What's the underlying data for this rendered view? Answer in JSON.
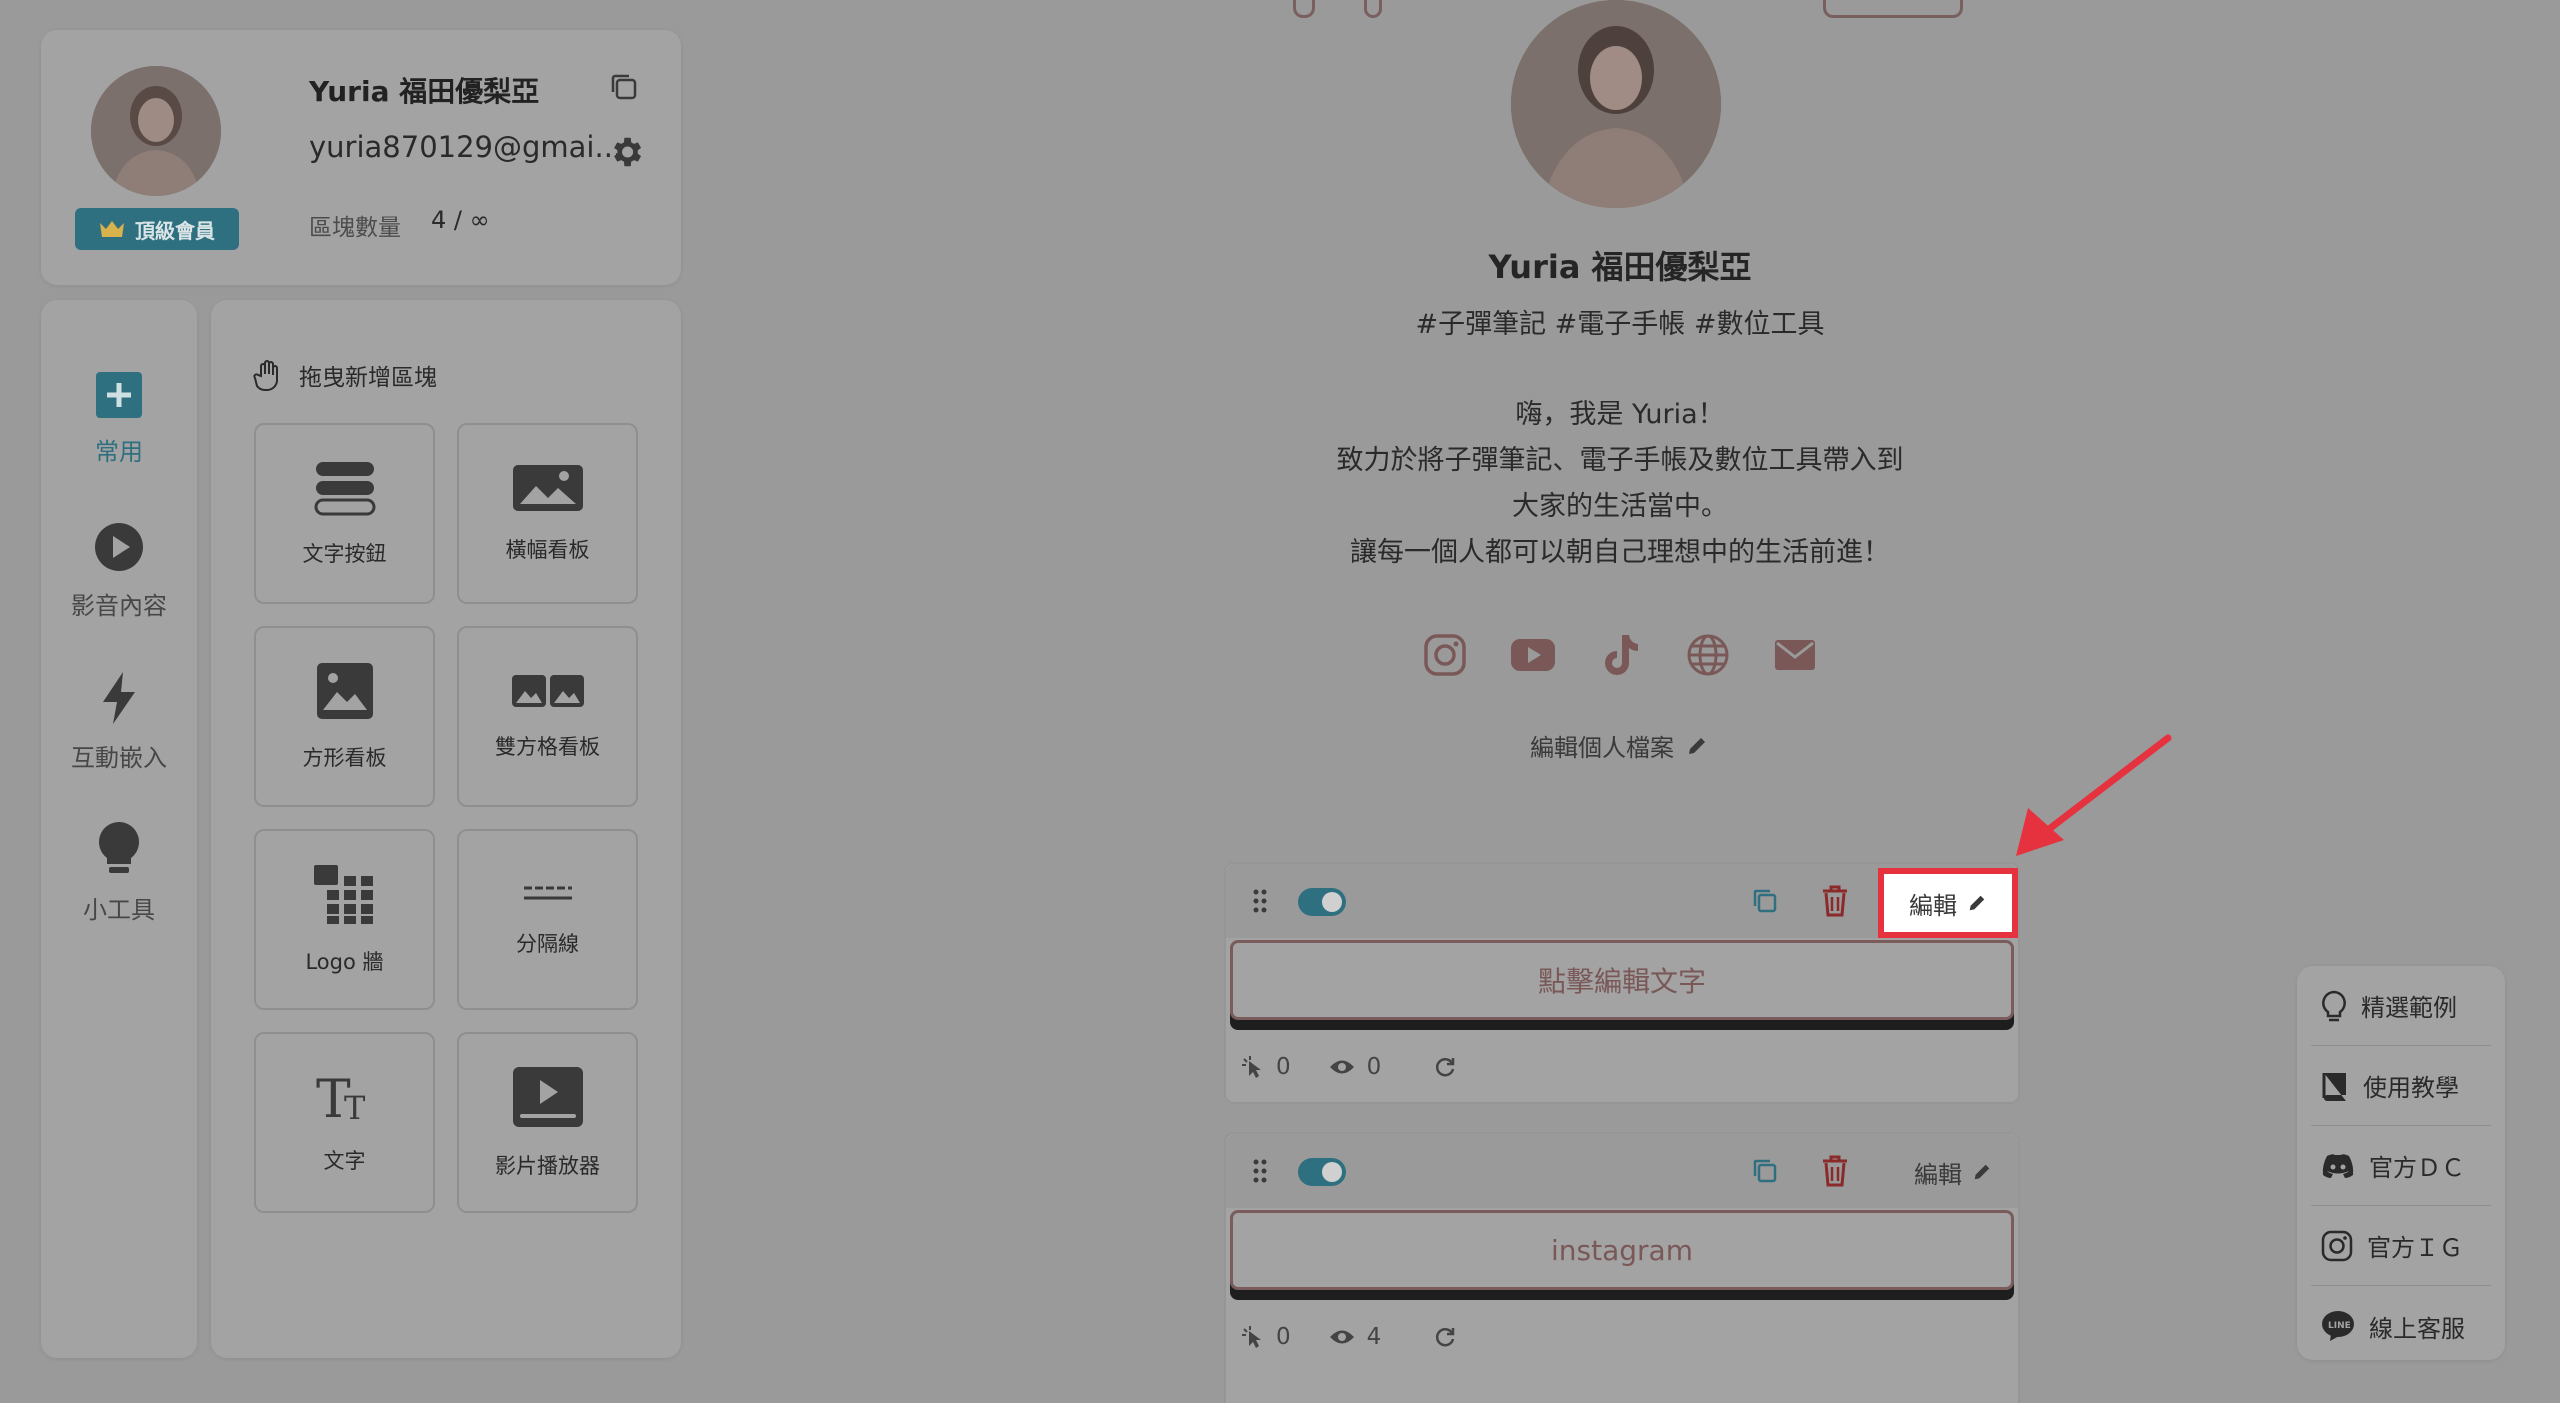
{
  "profile": {
    "name": "Yuria 福田優梨亞",
    "email": "yuria870129@gmai...",
    "membership_badge": "頂級會員",
    "block_count_label": "區塊數量",
    "block_count_value": "4 / ∞"
  },
  "categories": [
    {
      "label": "常用",
      "icon": "plus-icon",
      "active": true
    },
    {
      "label": "影音內容",
      "icon": "play-icon",
      "active": false
    },
    {
      "label": "互動嵌入",
      "icon": "bolt-icon",
      "active": false
    },
    {
      "label": "小工具",
      "icon": "bulb-icon",
      "active": false
    }
  ],
  "blocks_panel": {
    "title": "拖曳新增區塊",
    "tiles": [
      {
        "label": "文字按鈕",
        "icon": "text-button-icon"
      },
      {
        "label": "橫幅看板",
        "icon": "banner-icon"
      },
      {
        "label": "方形看板",
        "icon": "square-board-icon"
      },
      {
        "label": "雙方格看板",
        "icon": "double-grid-icon"
      },
      {
        "label": "Logo 牆",
        "icon": "logo-wall-icon"
      },
      {
        "label": "分隔線",
        "icon": "divider-icon"
      },
      {
        "label": "文字",
        "icon": "text-icon"
      },
      {
        "label": "影片播放器",
        "icon": "video-player-icon"
      }
    ]
  },
  "preview": {
    "name": "Yuria 福田優梨亞",
    "tags": "#子彈筆記 #電子手帳 #數位工具",
    "bio": [
      "嗨，我是 Yuria！",
      "致力於將子彈筆記、電子手帳及數位工具帶入到",
      "大家的生活當中。",
      "讓每一個人都可以朝自己理想中的生活前進！"
    ],
    "socials": [
      "instagram-icon",
      "youtube-icon",
      "tiktok-icon",
      "globe-icon",
      "mail-icon"
    ],
    "edit_profile_label": "編輯個人檔案"
  },
  "blocks": [
    {
      "edit_label": "編輯",
      "button_text": "點擊編輯文字",
      "clicks": "0",
      "views": "0",
      "enabled": true,
      "highlighted": true
    },
    {
      "edit_label": "編輯",
      "button_text": "instagram",
      "clicks": "0",
      "views": "4",
      "enabled": true,
      "highlighted": false
    }
  ],
  "help_menu": [
    {
      "label": "精選範例",
      "icon": "bulb-outline-icon"
    },
    {
      "label": "使用教學",
      "icon": "book-icon"
    },
    {
      "label": "官方ＤＣ",
      "icon": "discord-icon"
    },
    {
      "label": "官方ＩＧ",
      "icon": "instagram-icon"
    },
    {
      "label": "線上客服",
      "icon": "line-icon"
    }
  ],
  "colors": {
    "accent": "#2f7080",
    "highlight_box": "#e5323e",
    "arrow": "#e5323e",
    "button_border": "#7a5c5c"
  }
}
